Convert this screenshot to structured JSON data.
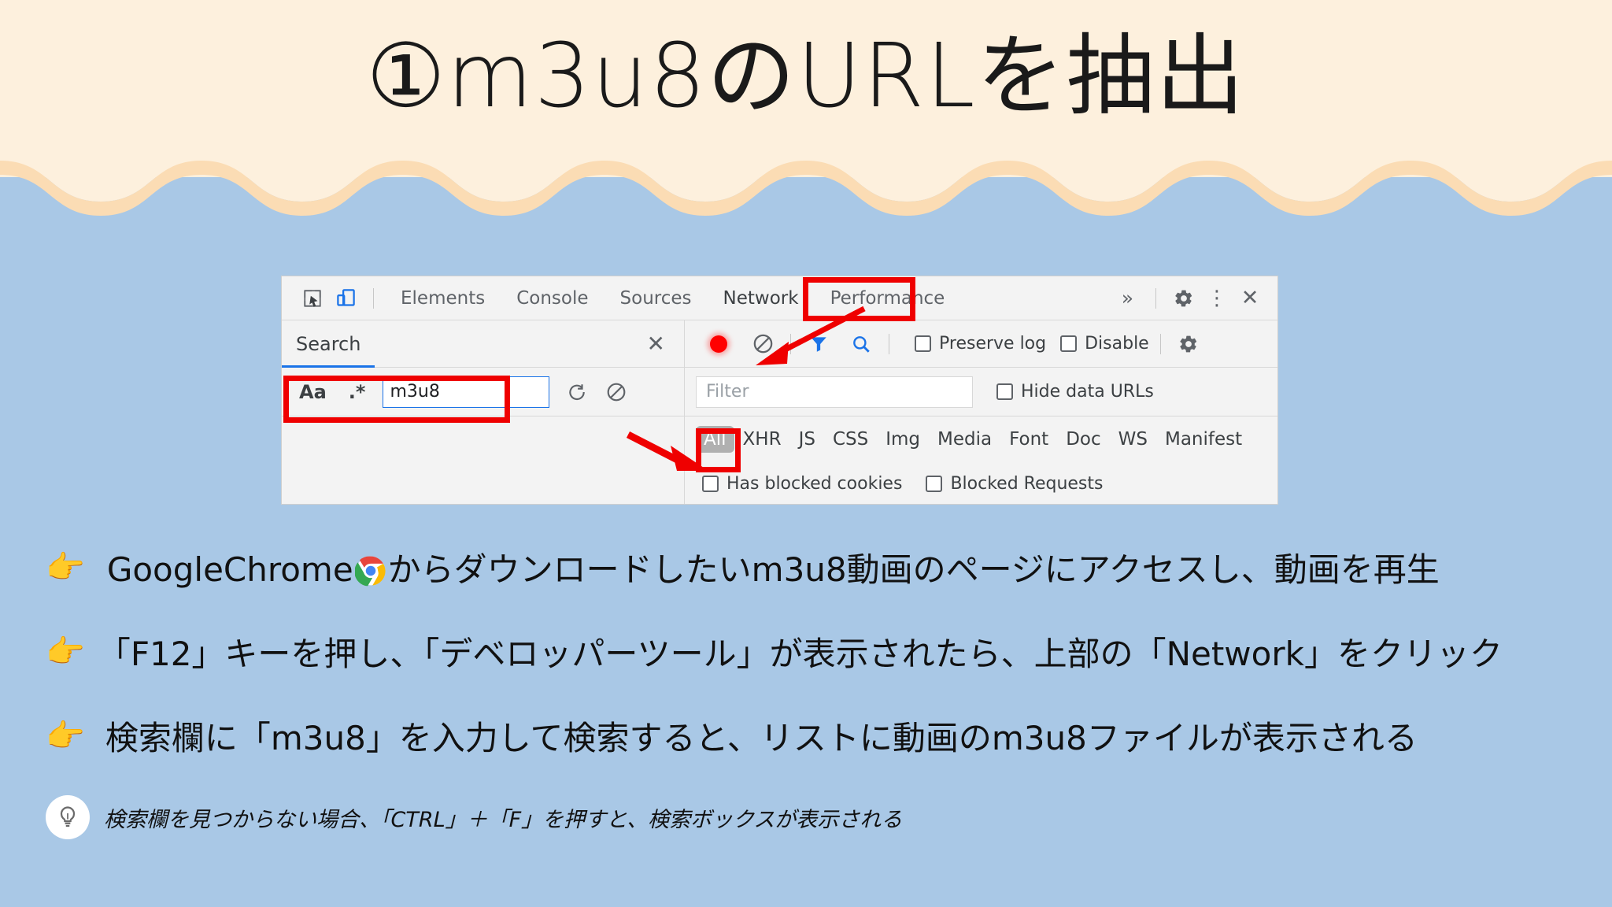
{
  "theme": {
    "band_color": "#fdf0dd",
    "body_color": "#a9c8e6",
    "accent_red": "#ef0000",
    "devtools_bg": "#f3f3f3",
    "link_blue": "#1a73e8"
  },
  "title": "①m3u8のURLを抽出",
  "devtools": {
    "icons": {
      "inspect": "inspect-element-icon",
      "device": "device-toolbar-icon",
      "overflow": "»",
      "gear": "gear-icon",
      "kebab": "⋮",
      "close": "✕"
    },
    "tabs": [
      {
        "label": "Elements",
        "active": false
      },
      {
        "label": "Console",
        "active": false
      },
      {
        "label": "Sources",
        "active": false
      },
      {
        "label": "Network",
        "active": true
      },
      {
        "label": "Performance",
        "active": false
      }
    ],
    "search_panel": {
      "header_label": "Search",
      "close_label": "✕",
      "case_label": "Aa",
      "regex_label": ".*",
      "query_value": "m3u8",
      "refresh_icon": "refresh-icon",
      "clear_icon": "clear-icon"
    },
    "network_panel": {
      "record_icon": "record-icon",
      "clear_icon": "clear-icon",
      "filter_icon": "filter-funnel-icon",
      "search_icon": "search-icon",
      "preserve_log_label": "Preserve log",
      "disable_cache_label": "Disable",
      "settings_icon": "gear-icon",
      "filter_placeholder": "Filter",
      "hide_data_urls_label": "Hide data URLs",
      "types": [
        {
          "label": "All",
          "selected": true
        },
        {
          "label": "XHR",
          "selected": false
        },
        {
          "label": "JS",
          "selected": false
        },
        {
          "label": "CSS",
          "selected": false
        },
        {
          "label": "Img",
          "selected": false
        },
        {
          "label": "Media",
          "selected": false
        },
        {
          "label": "Font",
          "selected": false
        },
        {
          "label": "Doc",
          "selected": false
        },
        {
          "label": "WS",
          "selected": false
        },
        {
          "label": "Manifest",
          "selected": false
        }
      ],
      "has_blocked_cookies_label": "Has blocked cookies",
      "blocked_requests_label": "Blocked Requests"
    }
  },
  "bullets": [
    {
      "hand": "👉",
      "text_before": "GoogleChrome",
      "text_after": "からダウンロードしたいm3u8動画のページにアクセスし、動画を再生",
      "has_chrome_logo": true
    },
    {
      "hand": "👉",
      "text_before": "「F12」キーを押し、「デベロッパーツール」が表示されたら、上部の「Network」をクリック",
      "text_after": "",
      "has_chrome_logo": false
    },
    {
      "hand": "👉",
      "text_before": "検索欄に「m3u8」を入力して検索すると、リストに動画のm3u8ファイルが表示される",
      "text_after": "",
      "has_chrome_logo": false
    }
  ],
  "tip": {
    "icon": "lightbulb-icon",
    "text": "検索欄を見つからない場合、「CTRL」＋「F」を押すと、検索ボックスが表示される"
  }
}
